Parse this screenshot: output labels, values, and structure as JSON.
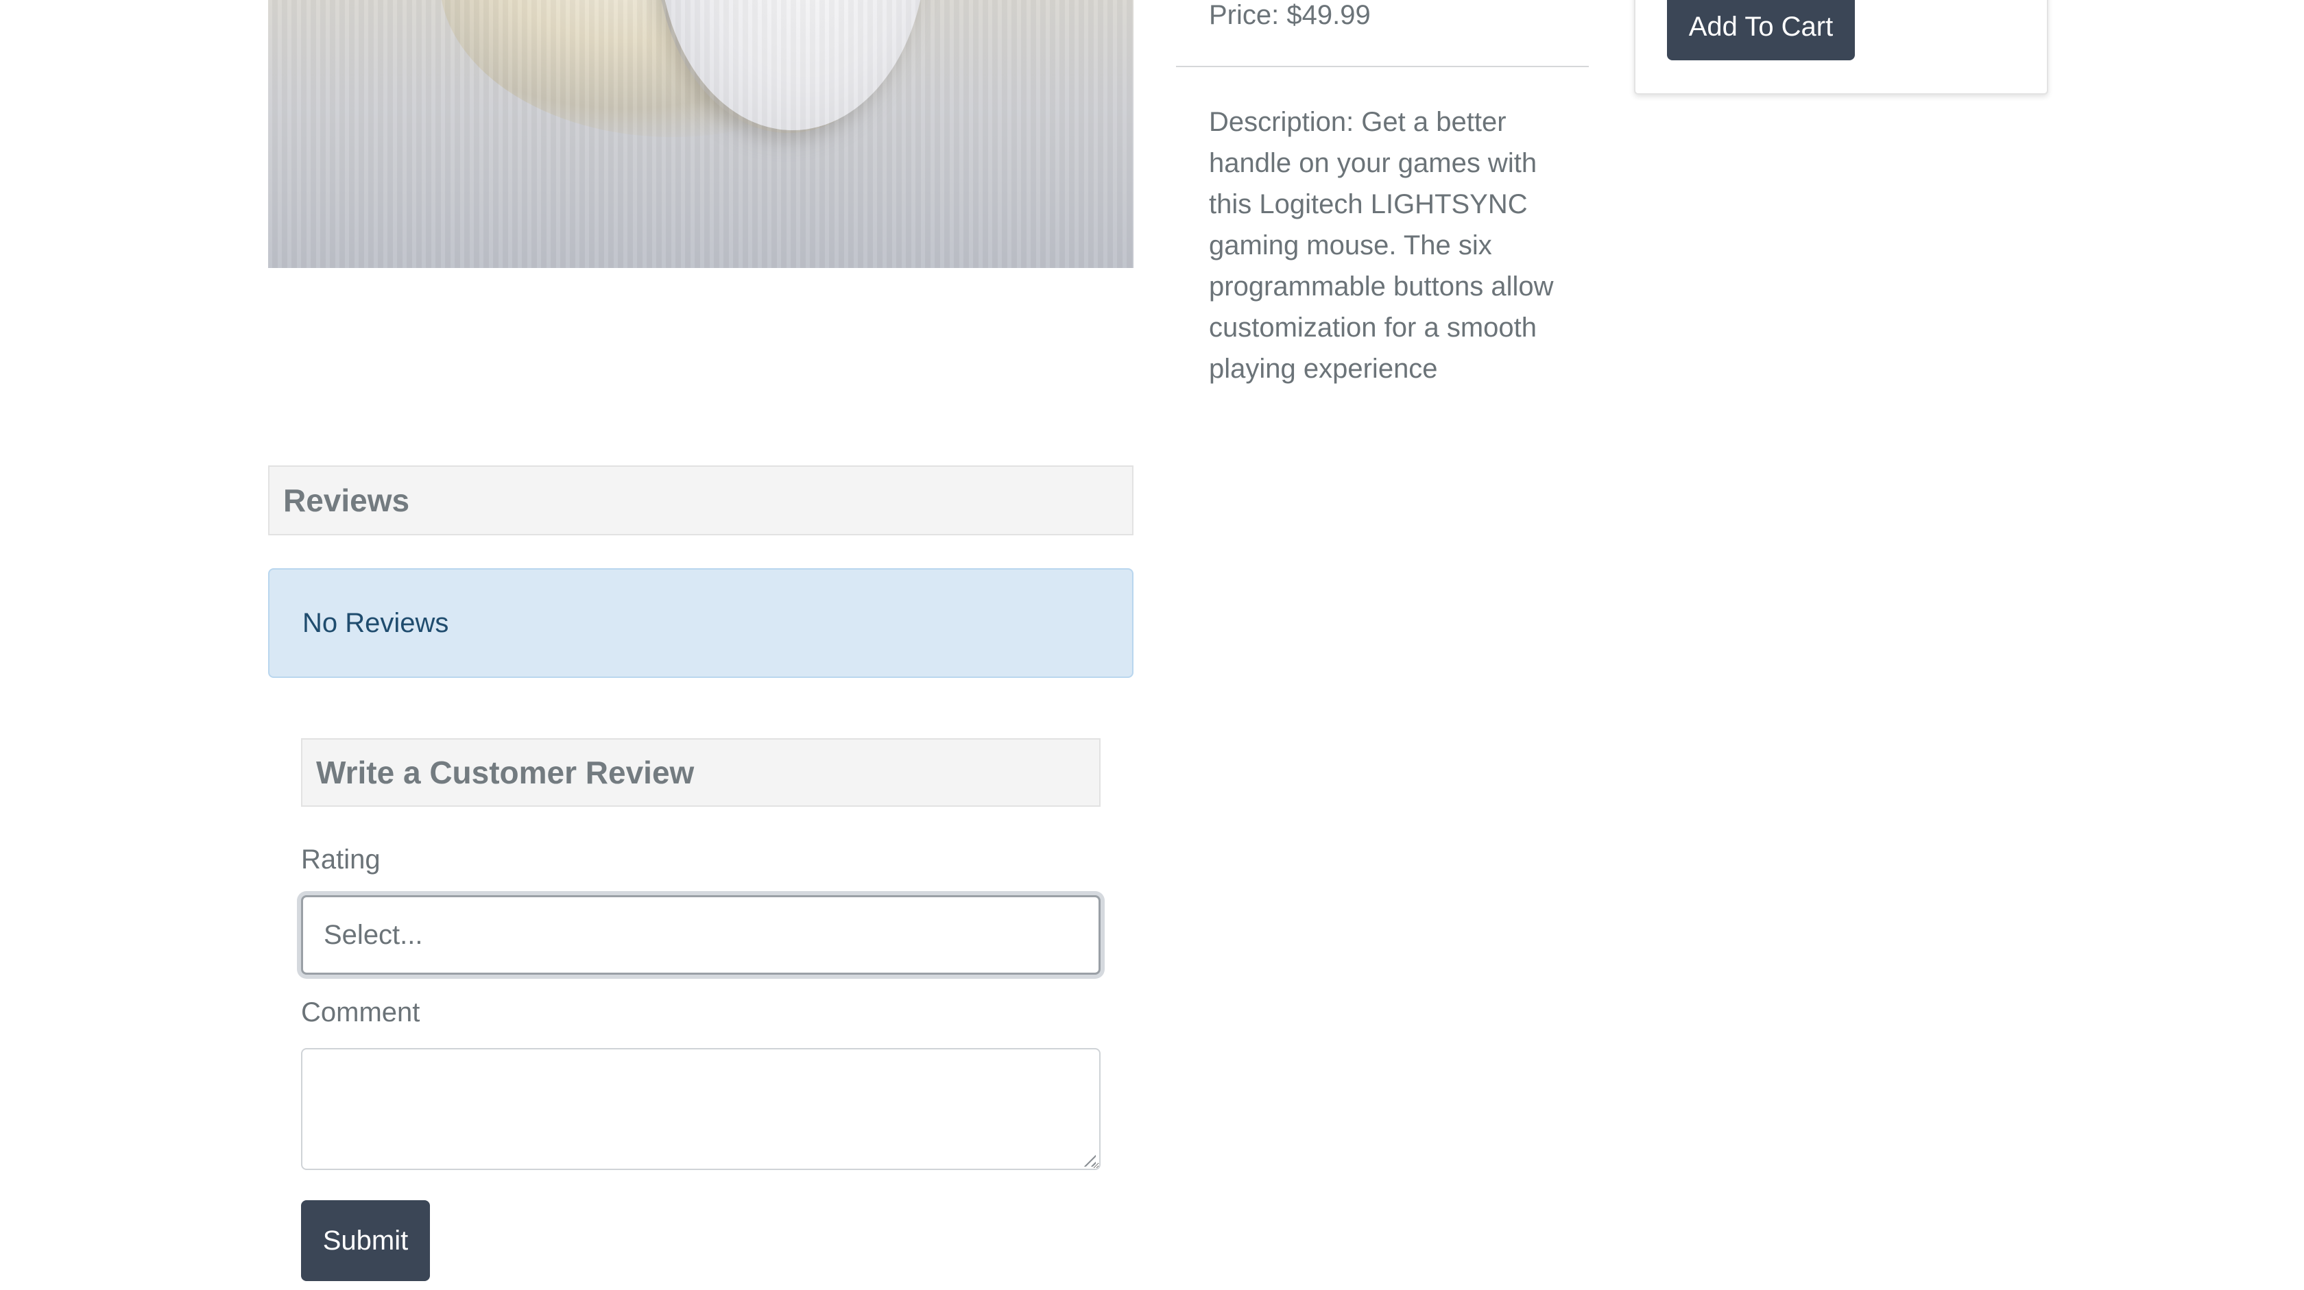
{
  "product": {
    "image_alt": "Logitech LIGHTSYNC gaming mouse",
    "price": "Price: $49.99",
    "description": "Description: Get a better handle on your games with this Logitech LIGHTSYNC gaming mouse. The six programmable buttons allow customization for a smooth playing experience"
  },
  "cart": {
    "add_to_cart_label": "Add To Cart"
  },
  "reviews": {
    "title": "Reviews",
    "empty_message": "No Reviews"
  },
  "review_form": {
    "title": "Write a Customer Review",
    "rating_label": "Rating",
    "rating_placeholder": "Select...",
    "comment_label": "Comment",
    "comment_value": "",
    "submit_label": "Submit"
  },
  "colors": {
    "button_dark": "#3b4656",
    "alert_info_bg": "#d9e8f5",
    "alert_info_text": "#1f4c6e",
    "muted_text": "#6b7378"
  }
}
